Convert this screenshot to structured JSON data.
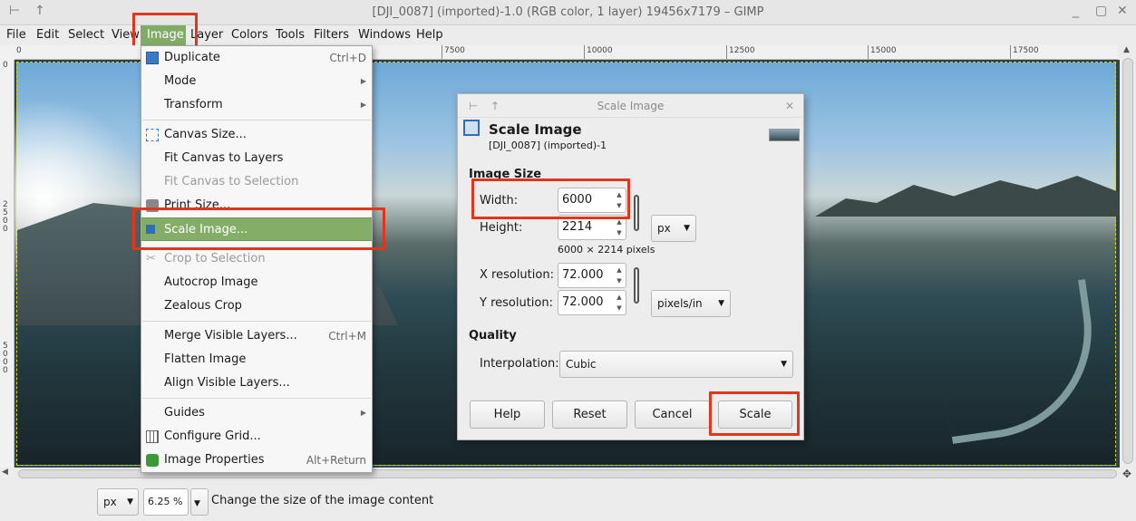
{
  "window": {
    "title": "[DJI_0087] (imported)-1.0 (RGB color, 1 layer) 19456x7179 – GIMP"
  },
  "menubar": {
    "items": [
      "File",
      "Edit",
      "Select",
      "View",
      "Image",
      "Layer",
      "Colors",
      "Tools",
      "Filters",
      "Windows",
      "Help"
    ]
  },
  "ruler": {
    "h_labels": [
      "0",
      "7500",
      "10000",
      "12500",
      "15000",
      "17500"
    ],
    "v_labels": [
      "0",
      "2500",
      "5000"
    ]
  },
  "image_menu": {
    "duplicate": "Duplicate",
    "duplicate_acc": "Ctrl+D",
    "mode": "Mode",
    "transform": "Transform",
    "canvas_size": "Canvas Size...",
    "fit_canvas_layers": "Fit Canvas to Layers",
    "fit_canvas_selection": "Fit Canvas to Selection",
    "print_size": "Print Size...",
    "scale_image": "Scale Image...",
    "crop_selection": "Crop to Selection",
    "autocrop": "Autocrop Image",
    "zealous_crop": "Zealous Crop",
    "merge_visible": "Merge Visible Layers...",
    "merge_acc": "Ctrl+M",
    "flatten": "Flatten Image",
    "align_visible": "Align Visible Layers...",
    "guides": "Guides",
    "configure_grid": "Configure Grid...",
    "image_properties": "Image Properties",
    "properties_acc": "Alt+Return"
  },
  "dialog": {
    "window_title": "Scale Image",
    "heading": "Scale Image",
    "subtitle": "[DJI_0087] (imported)-1",
    "image_size_label": "Image Size",
    "width_label": "Width:",
    "width_value": "6000",
    "height_label": "Height:",
    "height_value": "2214",
    "size_unit": "px",
    "pixels_info": "6000 × 2214 pixels",
    "xres_label": "X resolution:",
    "xres_value": "72.000",
    "yres_label": "Y resolution:",
    "yres_value": "72.000",
    "res_unit": "pixels/in",
    "quality_label": "Quality",
    "interp_label": "Interpolation:",
    "interp_value": "Cubic",
    "help_btn": "Help",
    "reset_btn": "Reset",
    "cancel_btn": "Cancel",
    "scale_btn": "Scale"
  },
  "statusbar": {
    "unit": "px",
    "zoom": "6.25 %",
    "message": "Change the size of the image content"
  },
  "colors": {
    "menu_highlight": "#84ad68",
    "annotation_red": "#e2361c"
  }
}
